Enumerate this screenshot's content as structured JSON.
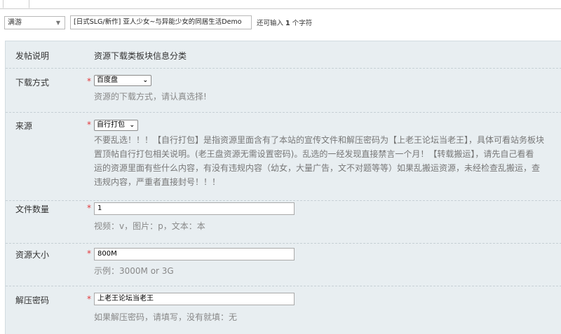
{
  "top": {
    "category_select": "满游",
    "title_value": "[日式SLG/新作] 亚人少女~与异能少女的同居生活Demo",
    "remain_prefix": "还可输入",
    "remain_count": "1",
    "remain_suffix": "个字符"
  },
  "info": {
    "label": "发帖说明",
    "value": "资源下载类板块信息分类"
  },
  "fields": {
    "download": {
      "label": "下载方式",
      "required": "*",
      "value": "百度盘",
      "hint": "资源的下载方式，请认真选择!"
    },
    "source": {
      "label": "来源",
      "required": "*",
      "value": "自行打包",
      "desc_lines": [
        "不要乱选！！！【自行打包】是指资源里面含有了本站的宣传文件和解压密码为【上老王论坛当老王】，具体可看站务板块",
        "置顶帖自行打包相关说明。(老王盘资源无需设置密码)。乱选的一经发现直接禁言一个月！【转载搬运】，请先自己看看",
        "运的资源里面有些什么内容，有没有违规内容（幼女，大量广告，文不对题等等）如果乱搬运资源，未经检查乱搬运，查",
        "违规内容，严重者直接封号！！！"
      ]
    },
    "file_count": {
      "label": "文件数量",
      "required": "*",
      "value": "1",
      "hint": "视频：v，图片：p，文本：本"
    },
    "size": {
      "label": "资源大小",
      "required": "*",
      "value": "800M",
      "hint": "示例：3000M or 3G"
    },
    "password": {
      "label": "解压密码",
      "required": "*",
      "value": "上老王论坛当老王",
      "hint": "如果解压密码，请填写，没有就填：无"
    }
  },
  "colors": {
    "panel_bg": "#e8eef1",
    "required": "#e4393c",
    "hint": "#888888"
  }
}
